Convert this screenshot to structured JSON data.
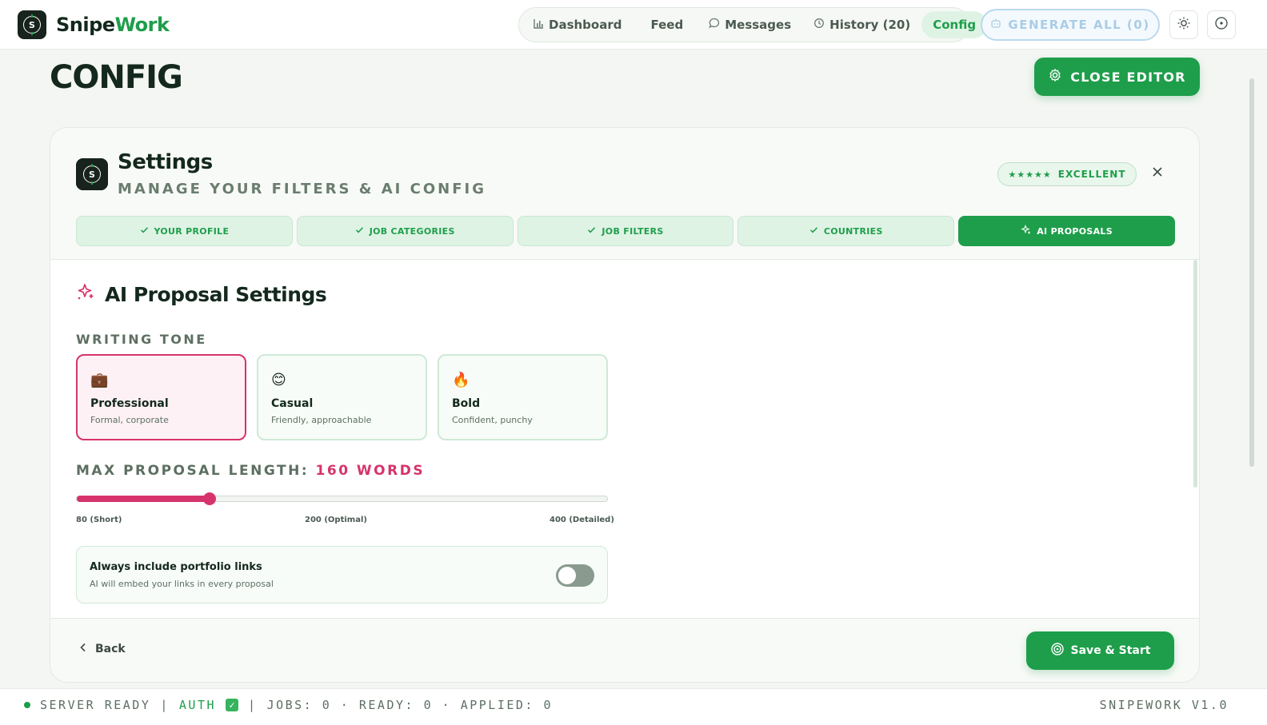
{
  "app": {
    "brand_part1": "Snipe",
    "brand_part2": "Work",
    "logo_letter": "S"
  },
  "nav": {
    "items": [
      {
        "label": "Dashboard",
        "icon": "chart-icon"
      },
      {
        "label": "Feed",
        "icon": ""
      },
      {
        "label": "Messages",
        "icon": "chat-bubble-icon"
      },
      {
        "label": "History (20)",
        "icon": "history-icon"
      },
      {
        "label": "Config",
        "icon": "",
        "active": true
      }
    ],
    "generate_all": "GENERATE ALL (0)"
  },
  "page": {
    "title": "CONFIG",
    "close_editor": "CLOSE EDITOR"
  },
  "settings": {
    "title": "Settings",
    "subtitle": "MANAGE YOUR FILTERS & AI CONFIG",
    "badge_stars": "★★★★★",
    "badge_label": "EXCELLENT",
    "tabs": [
      {
        "label": "YOUR PROFILE",
        "done": true
      },
      {
        "label": "JOB CATEGORIES",
        "done": true
      },
      {
        "label": "JOB FILTERS",
        "done": true
      },
      {
        "label": "COUNTRIES",
        "done": true
      },
      {
        "label": "AI PROPOSALS",
        "active": true
      }
    ]
  },
  "ai_proposals": {
    "section_title": "AI Proposal Settings",
    "writing_tone_label": "WRITING TONE",
    "tones": [
      {
        "name": "Professional",
        "desc": "Formal, corporate",
        "emoji": "💼",
        "selected": true
      },
      {
        "name": "Casual",
        "desc": "Friendly, approachable",
        "emoji": "😊"
      },
      {
        "name": "Bold",
        "desc": "Confident, punchy",
        "emoji": "🔥"
      }
    ],
    "max_length_label": "MAX PROPOSAL LENGTH: ",
    "max_length_value": "160 WORDS",
    "slider": {
      "min": 80,
      "max": 400,
      "value": 160
    },
    "tick_min": "80 (Short)",
    "tick_mid": "200 (Optimal)",
    "tick_max": "400 (Detailed)",
    "portfolio_title": "Always include portfolio links",
    "portfolio_desc": "AI will embed your links in every proposal",
    "portfolio_enabled": false
  },
  "footer": {
    "back": "Back",
    "save": "Save & Start"
  },
  "status": {
    "server": "SERVER READY",
    "sep1": "|",
    "auth": "AUTH",
    "sep2": "|",
    "counts": "JOBS: 0 · READY: 0 · APPLIED: 0",
    "version": "SNIPEWORK V1.0"
  },
  "colors": {
    "brand_green": "#1e9e4a",
    "accent_pink": "#d6336c",
    "dark": "#14281d"
  }
}
